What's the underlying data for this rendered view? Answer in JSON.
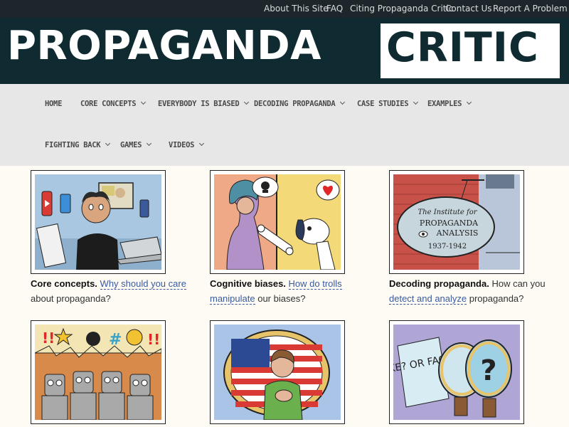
{
  "topbar": {
    "links": [
      "About This Site",
      "FAQ",
      "Citing Propaganda Critic",
      "Contact Us",
      "Report A Problem"
    ]
  },
  "logo": {
    "part1": "PROPAGANDA",
    "part2": "CRITIC"
  },
  "nav": {
    "items": [
      {
        "label": "HOME"
      },
      {
        "label": "CORE CONCEPTS"
      },
      {
        "label": "EVERYBODY IS BIASED"
      },
      {
        "label": "DECODING PROPAGANDA"
      },
      {
        "label": "CASE STUDIES"
      },
      {
        "label": "EXAMPLES"
      },
      {
        "label": "FIGHTING BACK"
      },
      {
        "label": "GAMES"
      },
      {
        "label": "VIDEOS"
      }
    ]
  },
  "cards": [
    {
      "title": "Core concepts.",
      "link": "Why should you care",
      "text": " about propaganda?"
    },
    {
      "title": "Cognitive biases.",
      "text_pre": " ",
      "link": "How do trolls manipulate",
      "text": " our biases?"
    },
    {
      "title": "Decoding propaganda.",
      "text_pre": " How can you ",
      "link": "detect and analyze",
      "text": " propaganda?"
    }
  ],
  "illustrations": {
    "sign_line1": "The Institute for",
    "sign_line2": "PROPAGANDA",
    "sign_line3": "ANALYSIS",
    "sign_years": "1937-1942",
    "fake_or_fact": "FAKE? OR FACT?"
  },
  "colors": {
    "topbar": "#1d262b",
    "banner": "#0f2a30",
    "nav_bg": "#e7e7e7",
    "link": "#3a5aa0",
    "page_bg": "#fdfbf3"
  }
}
